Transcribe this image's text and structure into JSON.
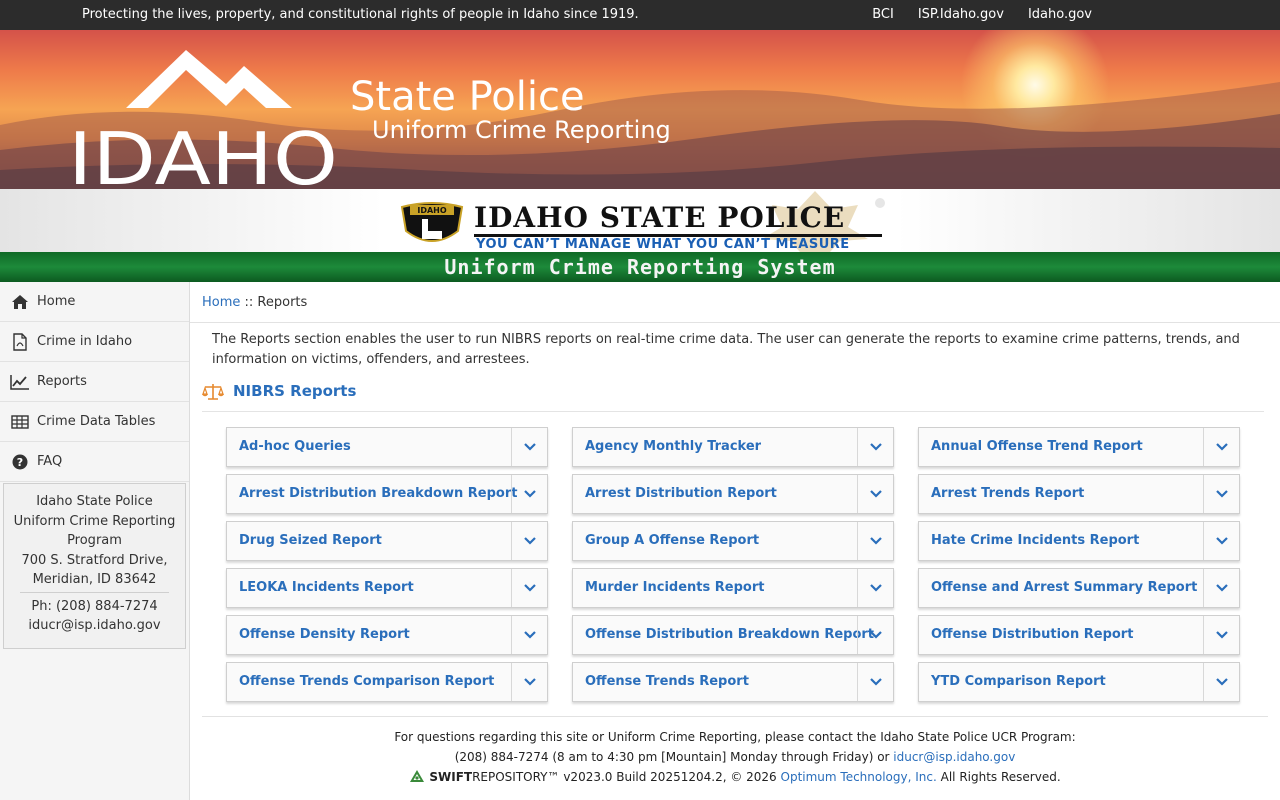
{
  "topbar": {
    "motto": "Protecting the lives, property, and constitutional rights of people in Idaho since 1919.",
    "links": [
      "BCI",
      "ISP.Idaho.gov",
      "Idaho.gov"
    ]
  },
  "banner": {
    "logo_text": "IDAHO",
    "title": "State Police",
    "subtitle": "Uniform Crime Reporting"
  },
  "isp": {
    "patch_text": "IDAHO",
    "title": "IDAHO STATE POLICE",
    "tagline": "YOU CAN’T MANAGE WHAT YOU CAN’T MEASURE",
    "system": "Uniform Crime Reporting System"
  },
  "sidebar": {
    "items": [
      {
        "label": "Home",
        "icon": "home-icon"
      },
      {
        "label": "Crime in Idaho",
        "icon": "pdf-icon"
      },
      {
        "label": "Reports",
        "icon": "line-chart-icon"
      },
      {
        "label": "Crime Data Tables",
        "icon": "table-icon"
      },
      {
        "label": "FAQ",
        "icon": "question-icon"
      }
    ],
    "contact": {
      "org": "Idaho State Police",
      "program": "Uniform Crime Reporting Program",
      "street": "700 S. Stratford Drive,",
      "city": "Meridian, ID 83642",
      "phone": "Ph: (208) 884-7274",
      "email": "iducr@isp.idaho.gov"
    }
  },
  "breadcrumb": {
    "home": "Home",
    "sep": " :: ",
    "current": "Reports"
  },
  "intro": "The Reports section enables the user to run NIBRS reports on real-time crime data. The user can generate the reports to examine crime patterns, trends, and information on victims, offenders, and arrestees.",
  "section_title": "NIBRS Reports",
  "reports": [
    "Ad-hoc Queries",
    "Agency Monthly Tracker",
    "Annual Offense Trend Report",
    "Arrest Distribution Breakdown Report",
    "Arrest Distribution Report",
    "Arrest Trends Report",
    "Drug Seized Report",
    "Group A Offense Report",
    "Hate Crime Incidents Report",
    "LEOKA Incidents Report",
    "Murder Incidents Report",
    "Offense and Arrest Summary Report",
    "Offense Density Report",
    "Offense Distribution Breakdown Report",
    "Offense Distribution Report",
    "Offense Trends Comparison Report",
    "Offense Trends Report",
    "YTD Comparison Report"
  ],
  "footer": {
    "line1": "For questions regarding this site or Uniform Crime Reporting, please contact the Idaho State Police UCR Program:",
    "line2": "(208) 884-7274 (8 am to 4:30 pm [Mountain] Monday through Friday) or ",
    "email": "iducr@isp.idaho.gov",
    "swift": "SWIFT",
    "repo": "REPOSITORY™",
    "build": "  v2023.0 Build 20251204.2, © 2026 ",
    "company": "Optimum Technology, Inc.",
    "rights": " All Rights Reserved."
  },
  "colors": {
    "link": "#2a6ebb",
    "green": "#1d8a3a",
    "topbar": "#2c2c2c"
  }
}
